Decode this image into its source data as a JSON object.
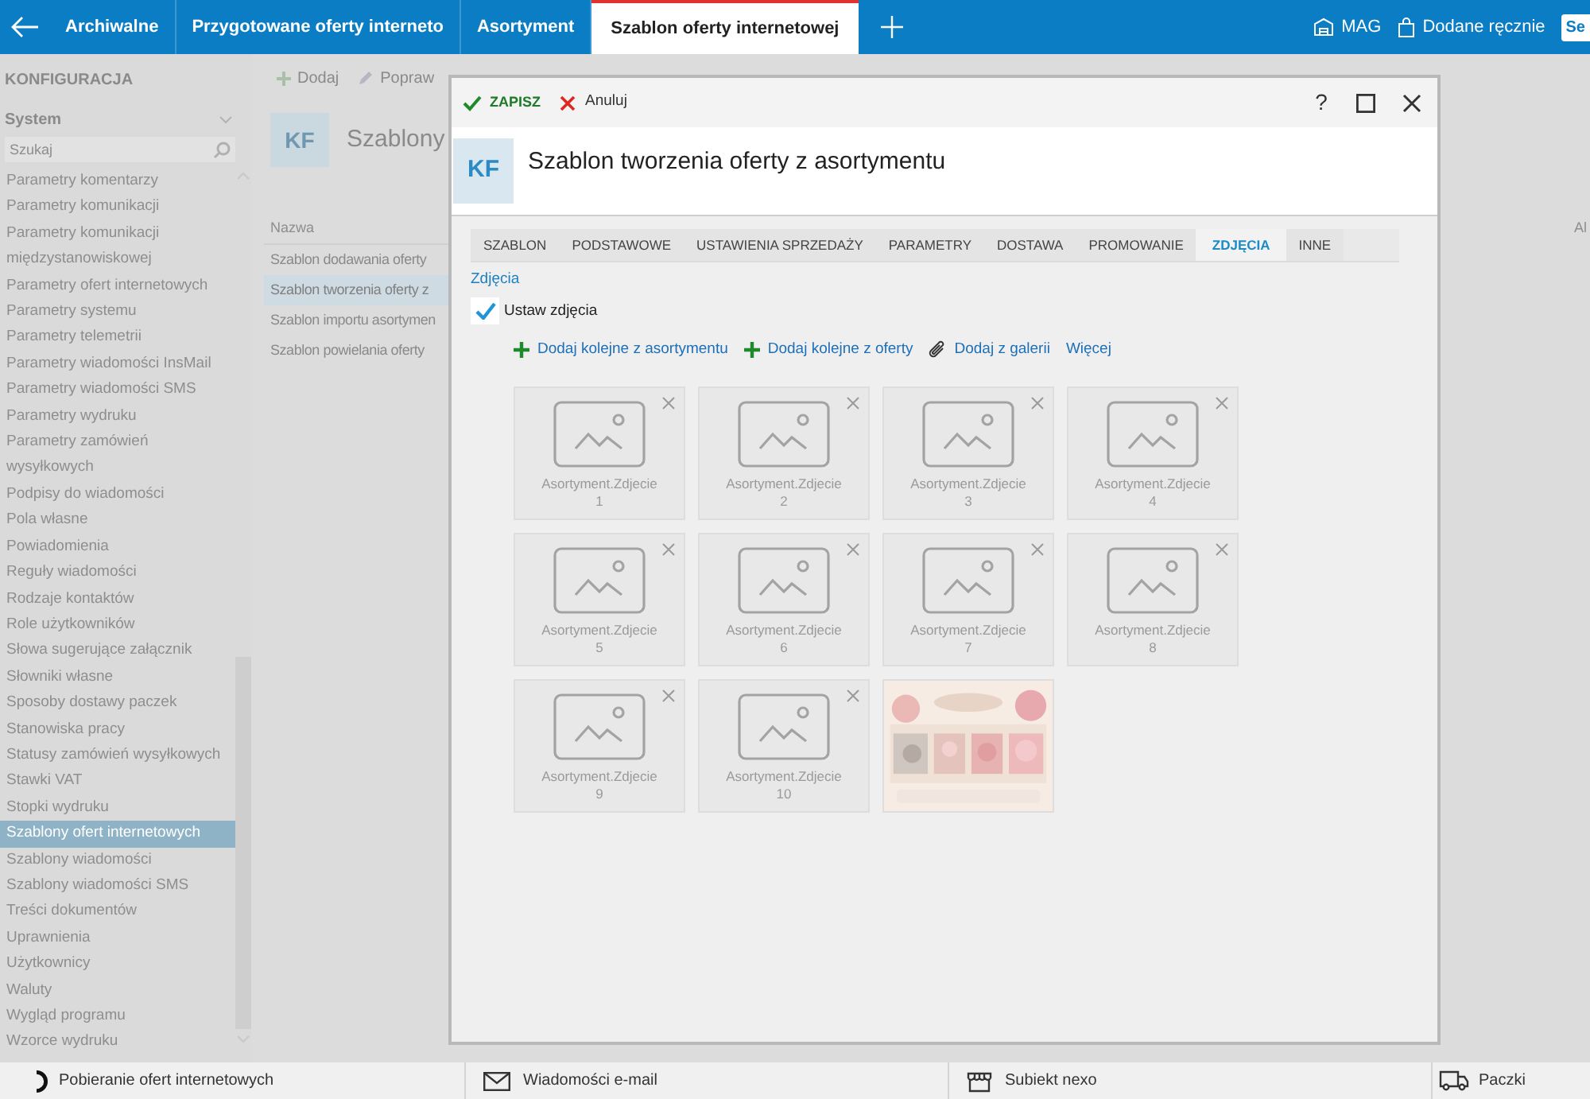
{
  "top_bar": {
    "tabs": [
      {
        "label": "Archiwalne",
        "selected": false
      },
      {
        "label": "Przygotowane oferty interneto",
        "selected": false
      },
      {
        "label": "Asortyment",
        "selected": false
      },
      {
        "label": "Szablon oferty internetowej",
        "selected": true
      }
    ],
    "right_items": [
      {
        "label": "MAG",
        "kind": "warehouse"
      },
      {
        "label": "Dodane ręcznie",
        "kind": "bag"
      }
    ],
    "cut_button": "Se"
  },
  "sidebar": {
    "title": "KONFIGURACJA",
    "group": "System",
    "search_placeholder": "Szukaj",
    "items": [
      {
        "label": "Parametry komentarzy",
        "selected": false
      },
      {
        "label": "Parametry komunikacji",
        "selected": false
      },
      {
        "label": "Parametry komunikacji międzystanowiskowej",
        "selected": false
      },
      {
        "label": "Parametry ofert internetowych",
        "selected": false
      },
      {
        "label": "Parametry systemu",
        "selected": false
      },
      {
        "label": "Parametry telemetrii",
        "selected": false
      },
      {
        "label": "Parametry wiadomości InsMail",
        "selected": false
      },
      {
        "label": "Parametry wiadomości SMS",
        "selected": false
      },
      {
        "label": "Parametry wydruku",
        "selected": false
      },
      {
        "label": "Parametry zamówień wysyłkowych",
        "selected": false
      },
      {
        "label": "Podpisy do wiadomości",
        "selected": false
      },
      {
        "label": "Pola własne",
        "selected": false
      },
      {
        "label": "Powiadomienia",
        "selected": false
      },
      {
        "label": "Reguły wiadomości",
        "selected": false
      },
      {
        "label": "Rodzaje kontaktów",
        "selected": false
      },
      {
        "label": "Role użytkowników",
        "selected": false
      },
      {
        "label": "Słowa sugerujące załącznik",
        "selected": false
      },
      {
        "label": "Słowniki własne",
        "selected": false
      },
      {
        "label": "Sposoby dostawy paczek",
        "selected": false
      },
      {
        "label": "Stanowiska pracy",
        "selected": false
      },
      {
        "label": "Statusy zamówień wysyłkowych",
        "selected": false
      },
      {
        "label": "Stawki VAT",
        "selected": false
      },
      {
        "label": "Stopki wydruku",
        "selected": false
      },
      {
        "label": "Szablony ofert internetowych",
        "selected": true
      },
      {
        "label": "Szablony wiadomości",
        "selected": false
      },
      {
        "label": "Szablony wiadomości SMS",
        "selected": false
      },
      {
        "label": "Treści dokumentów",
        "selected": false
      },
      {
        "label": "Uprawnienia",
        "selected": false
      },
      {
        "label": "Użytkownicy",
        "selected": false
      },
      {
        "label": "Waluty",
        "selected": false
      },
      {
        "label": "Wygląd programu",
        "selected": false
      },
      {
        "label": "Wzorce wydruku",
        "selected": false
      }
    ]
  },
  "main": {
    "toolbar": [
      {
        "label": "Dodaj",
        "kind": "plus"
      },
      {
        "label": "Popraw",
        "kind": "pencil"
      }
    ],
    "badge": "KF",
    "heading": "Szablony",
    "table": {
      "columns": [
        "Nazwa"
      ],
      "column_2": "Al",
      "rows": [
        {
          "text": "Szablon dodawania oferty",
          "selected": false
        },
        {
          "text": "Szablon tworzenia oferty z",
          "selected": true
        },
        {
          "text": "Szablon importu asortymen",
          "selected": false
        },
        {
          "text": "Szablon powielania oferty",
          "selected": false
        }
      ]
    }
  },
  "dialog": {
    "save": "ZAPISZ",
    "cancel": "Anuluj",
    "help": "?",
    "badge": "KF",
    "title": "Szablon tworzenia oferty z asortymentu",
    "tabs": [
      {
        "label": "SZABLON",
        "selected": false
      },
      {
        "label": "PODSTAWOWE",
        "selected": false
      },
      {
        "label": "USTAWIENIA SPRZEDAŻY",
        "selected": false
      },
      {
        "label": "PARAMETRY",
        "selected": false
      },
      {
        "label": "DOSTAWA",
        "selected": false
      },
      {
        "label": "PROMOWANIE",
        "selected": false
      },
      {
        "label": "ZDJĘCIA",
        "selected": true
      },
      {
        "label": "INNE",
        "selected": false
      }
    ],
    "section": "Zdjęcia",
    "checkbox": {
      "label": "Ustaw zdjęcia",
      "checked": true
    },
    "actions": [
      {
        "label": "Dodaj kolejne z asortymentu",
        "kind": "plus"
      },
      {
        "label": "Dodaj kolejne z oferty",
        "kind": "plus"
      },
      {
        "label": "Dodaj z galerii",
        "kind": "clip"
      },
      {
        "label": "Więcej",
        "kind": "link"
      }
    ],
    "photos": [
      {
        "kind": "placeholder",
        "label": "Asortyment.Zdjecie",
        "number": "1"
      },
      {
        "kind": "placeholder",
        "label": "Asortyment.Zdjecie",
        "number": "2"
      },
      {
        "kind": "placeholder",
        "label": "Asortyment.Zdjecie",
        "number": "3"
      },
      {
        "kind": "placeholder",
        "label": "Asortyment.Zdjecie",
        "number": "4"
      },
      {
        "kind": "placeholder",
        "label": "Asortyment.Zdjecie",
        "number": "5"
      },
      {
        "kind": "placeholder",
        "label": "Asortyment.Zdjecie",
        "number": "6"
      },
      {
        "kind": "placeholder",
        "label": "Asortyment.Zdjecie",
        "number": "7"
      },
      {
        "kind": "placeholder",
        "label": "Asortyment.Zdjecie",
        "number": "8"
      },
      {
        "kind": "placeholder",
        "label": "Asortyment.Zdjecie",
        "number": "9"
      },
      {
        "kind": "placeholder",
        "label": "Asortyment.Zdjecie",
        "number": "10"
      },
      {
        "kind": "picture"
      }
    ]
  },
  "status_bar": [
    {
      "label": "Pobieranie ofert internetowych",
      "kind": "spinner"
    },
    {
      "label": "Wiadomości e-mail",
      "kind": "mail"
    },
    {
      "label": "Subiekt nexo",
      "kind": "shop"
    },
    {
      "label": "Paczki",
      "kind": "truck"
    }
  ]
}
